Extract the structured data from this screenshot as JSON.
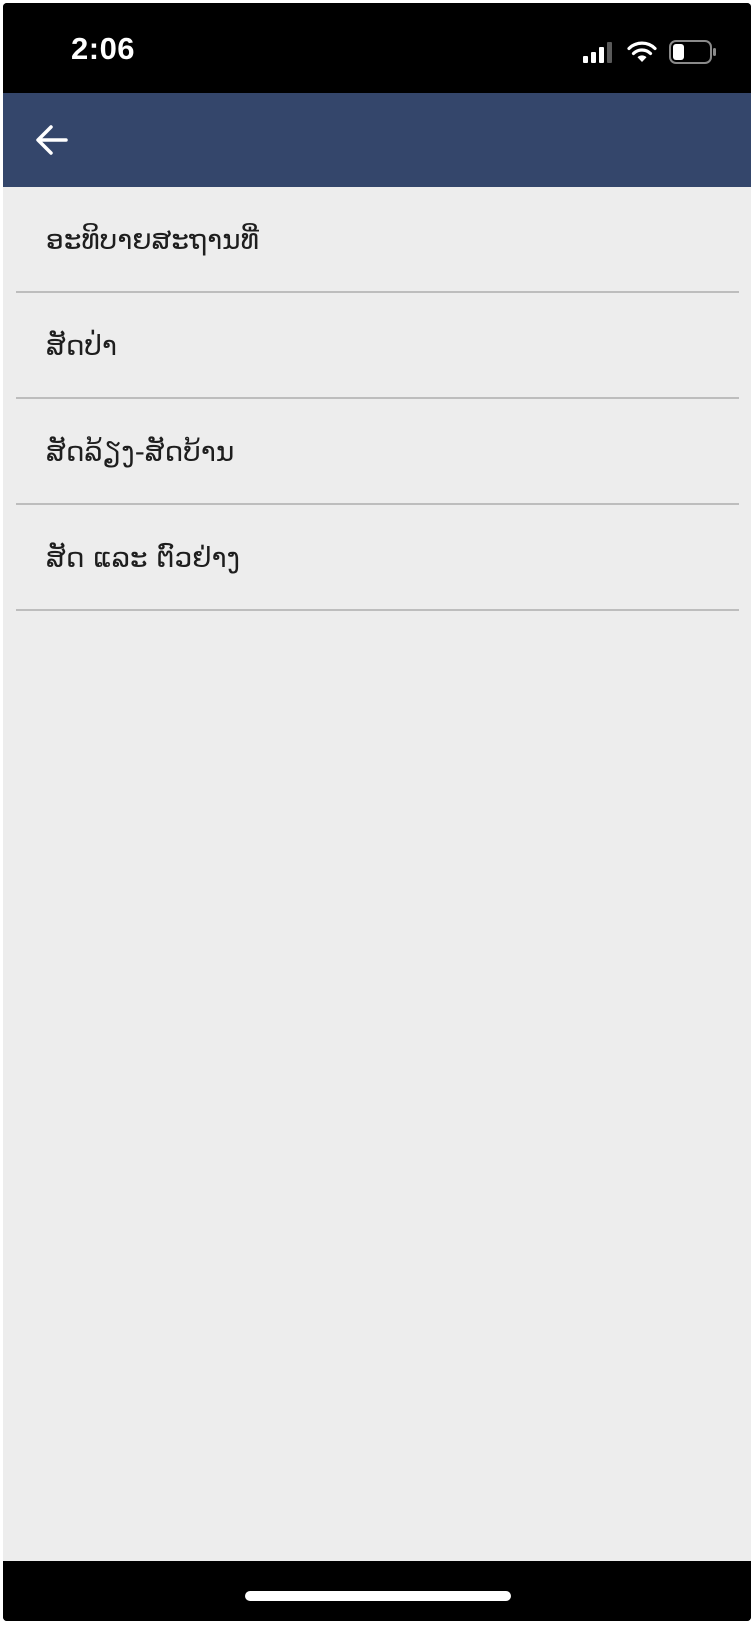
{
  "status_bar": {
    "time": "2:06"
  },
  "app_bar": {
    "back_icon": "arrow-left-icon"
  },
  "menu": {
    "items": [
      {
        "label": "ອະທິບາຍສະຖານທີ່"
      },
      {
        "label": "ສັດປ່າ"
      },
      {
        "label": "ສັດລ້ຽງ-ສັດບ້ານ"
      },
      {
        "label": "ສັດ ແລະ ຕົວຢ່າງ"
      }
    ]
  },
  "colors": {
    "app_bar": "#34466b",
    "background": "#ededed",
    "divider": "#bdbdbd"
  }
}
